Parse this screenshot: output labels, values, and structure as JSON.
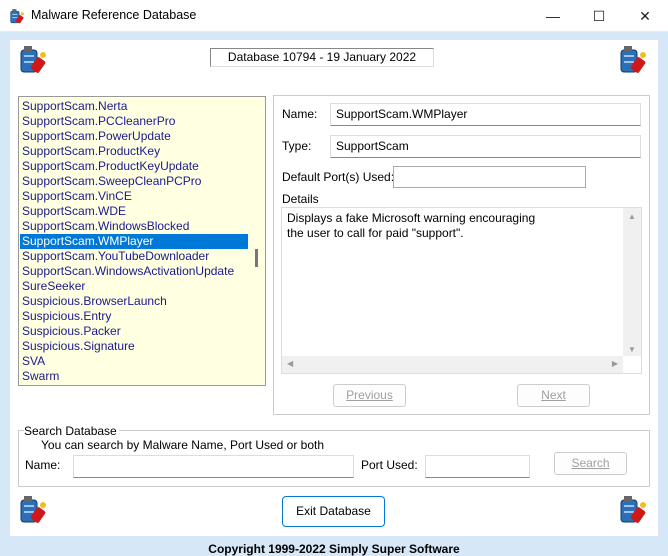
{
  "window": {
    "title": "Malware Reference Database",
    "minimize": "—",
    "maximize": "☐",
    "close": "✕"
  },
  "header": {
    "db_version": "Database 10794 - 19 January 2022"
  },
  "list": {
    "items": [
      "SupportScam.Nerta",
      "SupportScam.PCCleanerPro",
      "SupportScam.PowerUpdate",
      "SupportScam.ProductKey",
      "SupportScam.ProductKeyUpdate",
      "SupportScam.SweepCleanPCPro",
      "SupportScam.VinCE",
      "SupportScam.WDE",
      "SupportScam.WindowsBlocked",
      "SupportScam.WMPlayer",
      "SupportScam.YouTubeDownloader",
      "SupportScan.WindowsActivationUpdate",
      "SureSeeker",
      "Suspicious.BrowserLaunch",
      "Suspicious.Entry",
      "Suspicious.Packer",
      "Suspicious.Signature",
      "SVA",
      "Swarm"
    ],
    "selected": "SupportScam.WMPlayer",
    "text_color": "#1a1a8c",
    "background": "#ffffe1"
  },
  "detail": {
    "name_label": "Name:",
    "name_value": "SupportScam.WMPlayer",
    "type_label": "Type:",
    "type_value": "SupportScam",
    "port_label": "Default Port(s) Used:",
    "port_value": "",
    "details_label": "Details",
    "details_text": "Displays a fake Microsoft warning encouraging\nthe user to call for paid \"support\".",
    "previous_label": "Previous",
    "next_label": "Next"
  },
  "search": {
    "group_label": "Search Database",
    "hint": "You can search by Malware Name, Port Used or both",
    "name_label": "Name:",
    "name_value": "",
    "port_label": "Port Used:",
    "port_value": "",
    "button_label": "Search"
  },
  "footer": {
    "exit_label": "Exit Database",
    "copyright": "Copyright 1999-2022 Simply Super Software"
  }
}
